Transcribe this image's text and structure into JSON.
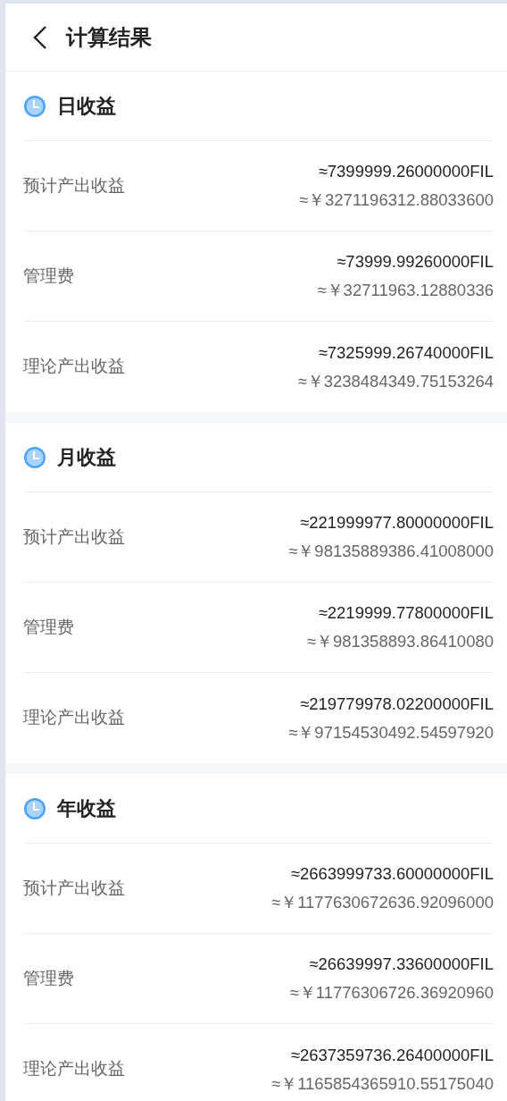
{
  "header": {
    "title": "计算结果"
  },
  "sections": [
    {
      "title": "日收益",
      "rows": [
        {
          "label": "预计产出收益",
          "fil": "≈7399999.26000000FIL",
          "cny": "≈￥3271196312.88033600"
        },
        {
          "label": "管理费",
          "fil": "≈73999.99260000FIL",
          "cny": "≈￥32711963.12880336"
        },
        {
          "label": "理论产出收益",
          "fil": "≈7325999.26740000FIL",
          "cny": "≈￥3238484349.75153264"
        }
      ]
    },
    {
      "title": "月收益",
      "rows": [
        {
          "label": "预计产出收益",
          "fil": "≈221999977.80000000FIL",
          "cny": "≈￥98135889386.41008000"
        },
        {
          "label": "管理费",
          "fil": "≈2219999.77800000FIL",
          "cny": "≈￥981358893.86410080"
        },
        {
          "label": "理论产出收益",
          "fil": "≈219779978.02200000FIL",
          "cny": "≈￥97154530492.54597920"
        }
      ]
    },
    {
      "title": "年收益",
      "rows": [
        {
          "label": "预计产出收益",
          "fil": "≈2663999733.60000000FIL",
          "cny": "≈￥1177630672636.92096000"
        },
        {
          "label": "管理费",
          "fil": "≈26639997.33600000FIL",
          "cny": "≈￥11776306726.36920960"
        },
        {
          "label": "理论产出收益",
          "fil": "≈2637359736.26400000FIL",
          "cny": "≈￥1165854365910.55175040"
        }
      ]
    }
  ]
}
